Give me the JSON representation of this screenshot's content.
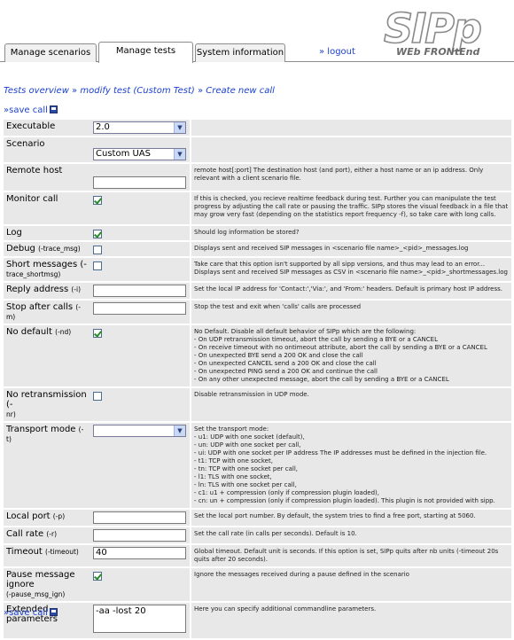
{
  "logo": {
    "text": "SIPp",
    "subtitle": "WEb FRONtEnd"
  },
  "tabs": [
    {
      "label": "Manage scenarios"
    },
    {
      "label": "Manage tests"
    },
    {
      "label": "System information"
    }
  ],
  "logout_label": "» logout",
  "breadcrumb": {
    "item1": "Tests overview",
    "sep1": " » ",
    "item2": "modify test (Custom Test)",
    "sep2": " » ",
    "item3": "Create new call"
  },
  "save_label": "»save call",
  "colors": {
    "link": "#1a3fd0",
    "row_bg": "#e8e8e8",
    "tab_bg": "#f1f1f1"
  },
  "fields": {
    "executable": {
      "label": "Executable",
      "value": "2.0"
    },
    "scenario": {
      "label": "Scenario",
      "value": "Custom UAS"
    },
    "remote_host": {
      "label": "Remote host",
      "desc": "remote host[:port] The destination host (and port), either a host name or an ip address. Only relevant with a client scenario file."
    },
    "monitor_call": {
      "label": "Monitor call",
      "checked": true,
      "desc": "If this is checked, you recieve realtime feedback during test. Further you can manipulate the test progress by adjusting the call rate or pausing the traffic. SIPp stores the visual feedback in a file that may grow very fast (depending on the statistics report frequency -f), so take care with long calls."
    },
    "log": {
      "label": "Log",
      "checked": true,
      "desc": "Should log information be stored?"
    },
    "debug": {
      "label": "Debug",
      "opt": "(-trace_msg)",
      "checked": false,
      "desc": "Displays sent and received SIP messages in <scenario file name>_<pid>_messages.log"
    },
    "short_messages": {
      "label": "Short messages (-",
      "opt": "trace_shortmsg)",
      "checked": false,
      "desc": "Take care that this option isn't supported by all sipp versions, and thus may lead to an error... Displays sent and received SIP messages as CSV in <scenario file name>_<pid>_shortmessages.log"
    },
    "reply_address": {
      "label": "Reply address",
      "opt": "(-i)",
      "desc": "Set the local IP address for 'Contact:','Via:', and 'From:' headers. Default is primary host IP address."
    },
    "stop_after_calls": {
      "label": "Stop after calls",
      "opt": "(-m)",
      "desc": "Stop the test and exit when 'calls' calls are processed"
    },
    "no_default": {
      "label": "No default",
      "opt": "(-nd)",
      "checked": true,
      "desc_lines": [
        "No Default. Disable all default behavior of SIPp which are the following:",
        "- On UDP retransmission timeout, abort the call by sending a BYE or a CANCEL",
        "- On receive timeout with no ontimeout attribute, abort the call by sending a BYE or a CANCEL",
        "- On unexpected BYE send a 200 OK and close the call",
        "- On unexpected CANCEL send a 200 OK and close the call",
        "- On unexpected PING send a 200 OK and continue the call",
        "- On any other unexpected message, abort the call by sending a BYE or a CANCEL"
      ]
    },
    "no_retransmission": {
      "label": "No retransmission (-",
      "opt": "nr)",
      "checked": false,
      "desc": "Disable retransmission in UDP mode."
    },
    "transport_mode": {
      "label": "Transport mode",
      "opt": "(-t)",
      "value": "",
      "desc_lines": [
        "Set the transport mode:",
        "- u1: UDP with one socket (default),",
        "- un: UDP with one socket per call,",
        "- ui: UDP with one socket per IP address The IP addresses must be defined in the injection file.",
        "- t1: TCP with one socket,",
        "- tn: TCP with one socket per call,",
        "- l1: TLS with one socket,",
        "- ln: TLS with one socket per call,",
        "- c1: u1 + compression (only if compression plugin loaded),",
        "- cn: un + compression (only if compression plugin loaded). This plugin is not provided with sipp."
      ]
    },
    "local_port": {
      "label": "Local port",
      "opt": "(-p)",
      "desc": "Set the local port number. By default, the system tries to find a free port, starting at 5060."
    },
    "call_rate": {
      "label": "Call rate",
      "opt": "(-r)",
      "desc": "Set the call rate (in calls per seconds). Default is 10."
    },
    "timeout": {
      "label": "Timeout",
      "opt": "(-timeout)",
      "value": "40",
      "desc": "Global timeout. Default unit is seconds. If this option is set, SIPp quits after nb units (-timeout 20s quits after 20 seconds)."
    },
    "pause_msg": {
      "label": "Pause message ignore",
      "opt": "(-pause_msg_ign)",
      "checked": true,
      "desc": "Ignore the messages received during a pause defined in the scenario"
    },
    "extended": {
      "label": "Extended parameters",
      "value": "-aa -lost 20",
      "desc": "Here you can specify additional commandline parameters."
    }
  }
}
